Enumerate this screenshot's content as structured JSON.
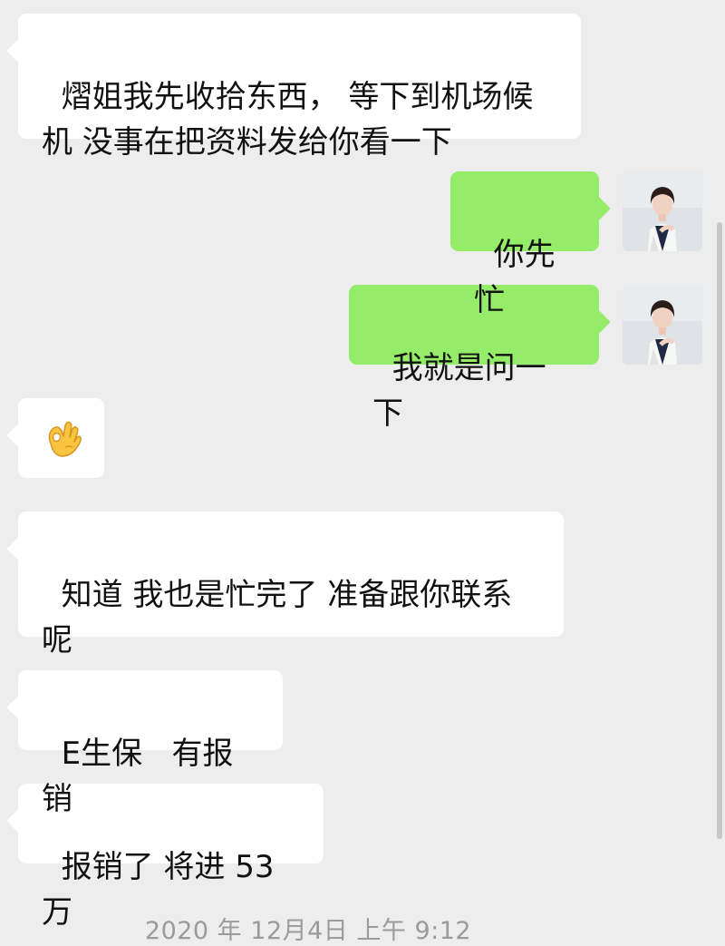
{
  "messages": [
    {
      "side": "left",
      "text": "熠姐我先收拾东西， 等下到机场候机 没事在把资料发给你看一下"
    },
    {
      "side": "right",
      "text": "你先忙"
    },
    {
      "side": "right",
      "text": "我就是问一下"
    },
    {
      "side": "left",
      "emoji": "ok-hand"
    },
    {
      "side": "left",
      "text": "知道 我也是忙完了 准备跟你联系呢"
    },
    {
      "side": "left",
      "text": "E生保   有报销"
    },
    {
      "side": "left",
      "text": "报销了 将进 53万"
    }
  ],
  "timestamp": "2020 年 12月4日 上午 9:12",
  "colors": {
    "background": "#ededed",
    "incoming_bubble": "#ffffff",
    "outgoing_bubble": "#95ec69",
    "timestamp_text": "#9b9b9b"
  }
}
